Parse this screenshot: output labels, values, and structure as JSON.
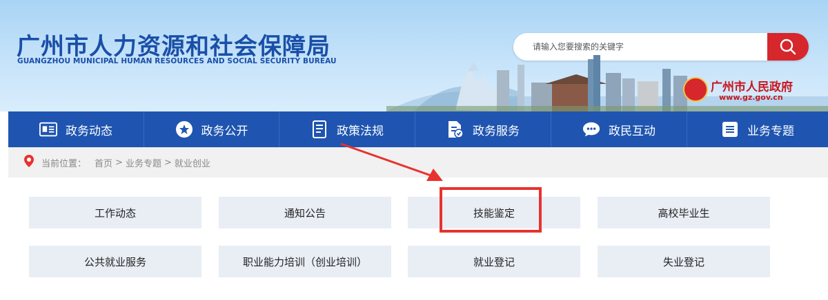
{
  "header": {
    "title": "广州市人力资源和社会保障局",
    "subtitle": "GUANGZHOU MUNICIPAL HUMAN RESOURCES AND SOCIAL SECURITY BUREAU",
    "gov_name": "广州市人民政府",
    "gov_url": "www.gz.gov.cn"
  },
  "search": {
    "placeholder": "请输入您要搜索的关键字",
    "button_icon": "search-icon"
  },
  "nav": {
    "items": [
      {
        "label": "政务动态",
        "icon": "news-icon"
      },
      {
        "label": "政务公开",
        "icon": "star-icon"
      },
      {
        "label": "政策法规",
        "icon": "book-icon"
      },
      {
        "label": "政务服务",
        "icon": "document-check-icon"
      },
      {
        "label": "政民互动",
        "icon": "chat-icon"
      },
      {
        "label": "业务专题",
        "icon": "list-icon"
      }
    ]
  },
  "breadcrumb": {
    "label": "当前位置：",
    "items": [
      "首页",
      "业务专题",
      "就业创业"
    ],
    "separator": ">"
  },
  "tiles": [
    [
      "工作动态",
      "通知公告",
      "技能鉴定",
      "高校毕业生"
    ],
    [
      "公共就业服务",
      "职业能力培训（创业培训）",
      "就业登记",
      "失业登记"
    ]
  ],
  "colors": {
    "brand_blue": "#1f55b0",
    "title_blue": "#1a4fa8",
    "accent_red": "#d5272c",
    "annotation_red": "#e8322e",
    "tile_bg": "#e9eef5"
  }
}
